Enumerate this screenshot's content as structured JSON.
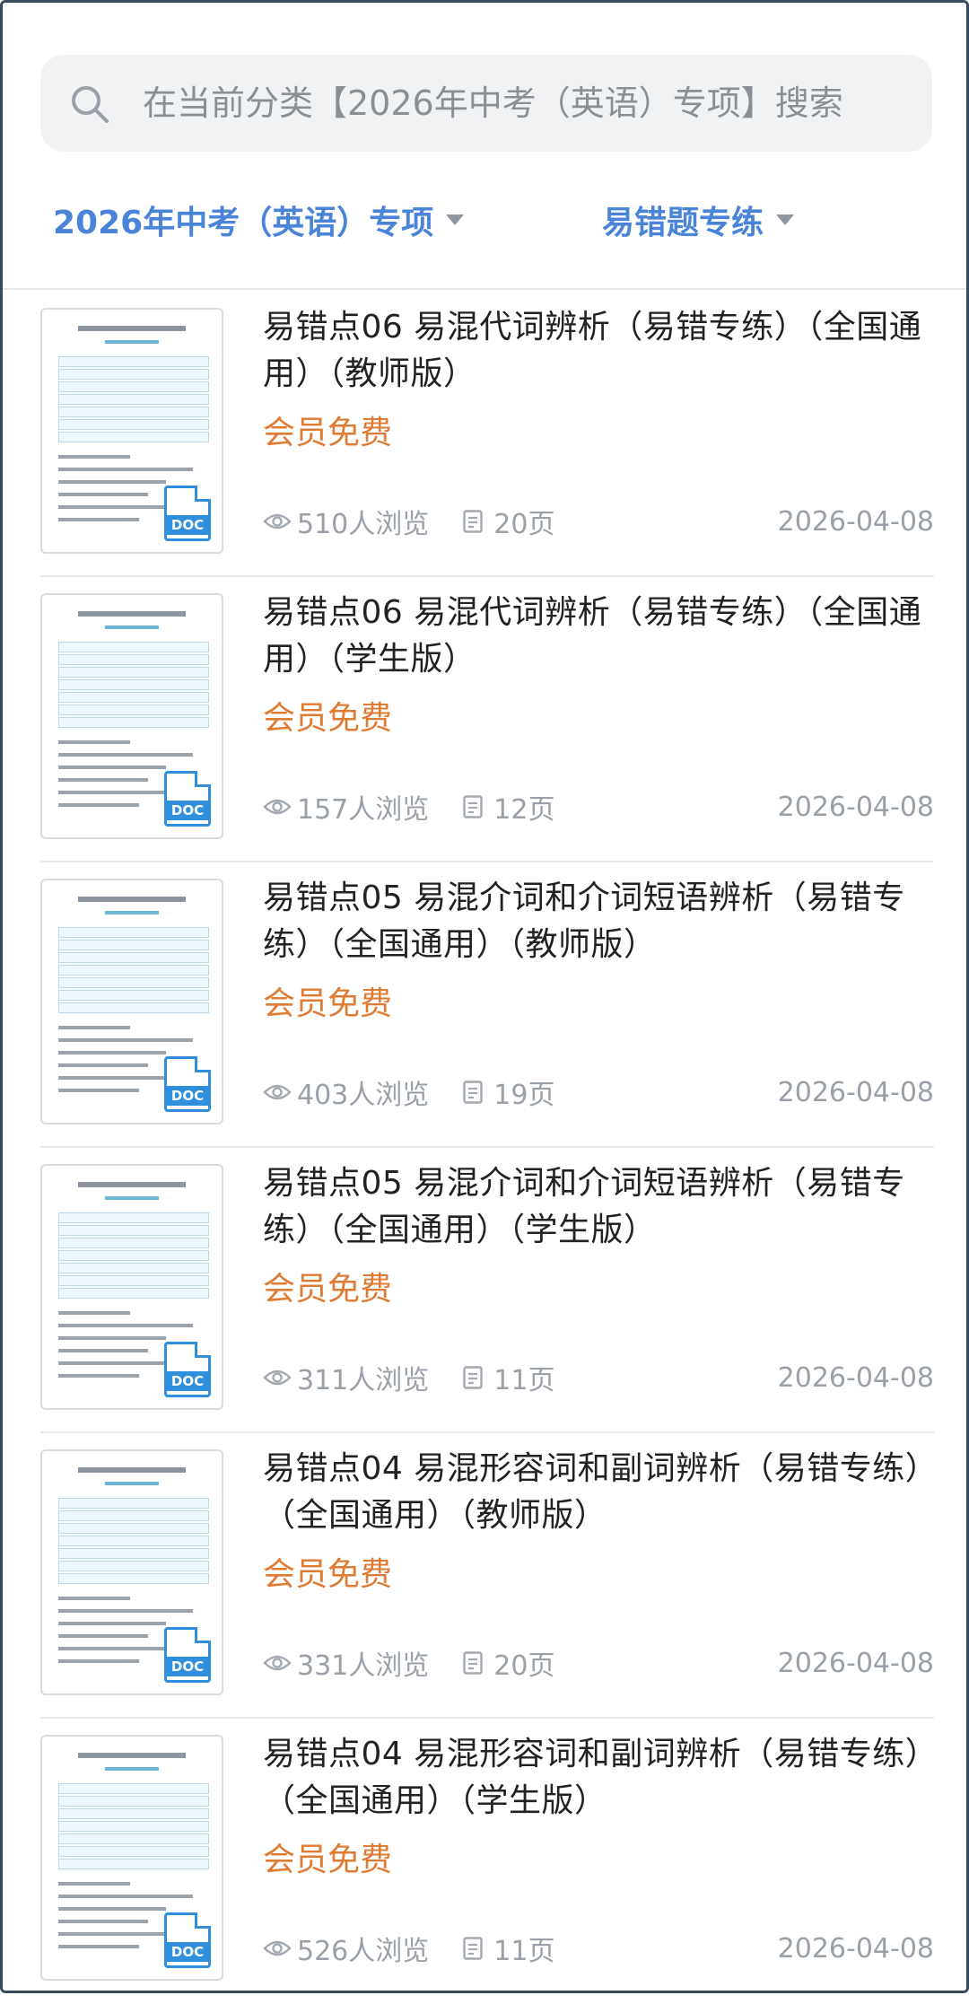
{
  "search": {
    "placeholder": "在当前分类【2026年中考（英语）专项】搜索"
  },
  "filters": [
    {
      "label": "2026年中考（英语）专项"
    },
    {
      "label": "易错题专练"
    }
  ],
  "items": [
    {
      "title": "易错点06 易混代词辨析（易错专练）（全国通用）（教师版）",
      "tag": "会员免费",
      "views": "510人浏览",
      "pages": "20页",
      "date": "2026-04-08",
      "badge": "DOC"
    },
    {
      "title": "易错点06 易混代词辨析（易错专练）（全国通用）（学生版）",
      "tag": "会员免费",
      "views": "157人浏览",
      "pages": "12页",
      "date": "2026-04-08",
      "badge": "DOC"
    },
    {
      "title": "易错点05 易混介词和介词短语辨析（易错专练）（全国通用）（教师版）",
      "tag": "会员免费",
      "views": "403人浏览",
      "pages": "19页",
      "date": "2026-04-08",
      "badge": "DOC"
    },
    {
      "title": "易错点05 易混介词和介词短语辨析（易错专练）（全国通用）（学生版）",
      "tag": "会员免费",
      "views": "311人浏览",
      "pages": "11页",
      "date": "2026-04-08",
      "badge": "DOC"
    },
    {
      "title": "易错点04 易混形容词和副词辨析（易错专练）（全国通用）（教师版）",
      "tag": "会员免费",
      "views": "331人浏览",
      "pages": "20页",
      "date": "2026-04-08",
      "badge": "DOC"
    },
    {
      "title": "易错点04 易混形容词和副词辨析（易错专练）（全国通用）（学生版）",
      "tag": "会员免费",
      "views": "526人浏览",
      "pages": "11页",
      "date": "2026-04-08",
      "badge": "DOC"
    }
  ],
  "colors": {
    "accent": "#4a84d8",
    "tag": "#e07b34",
    "doc": "#2f8fdc"
  }
}
